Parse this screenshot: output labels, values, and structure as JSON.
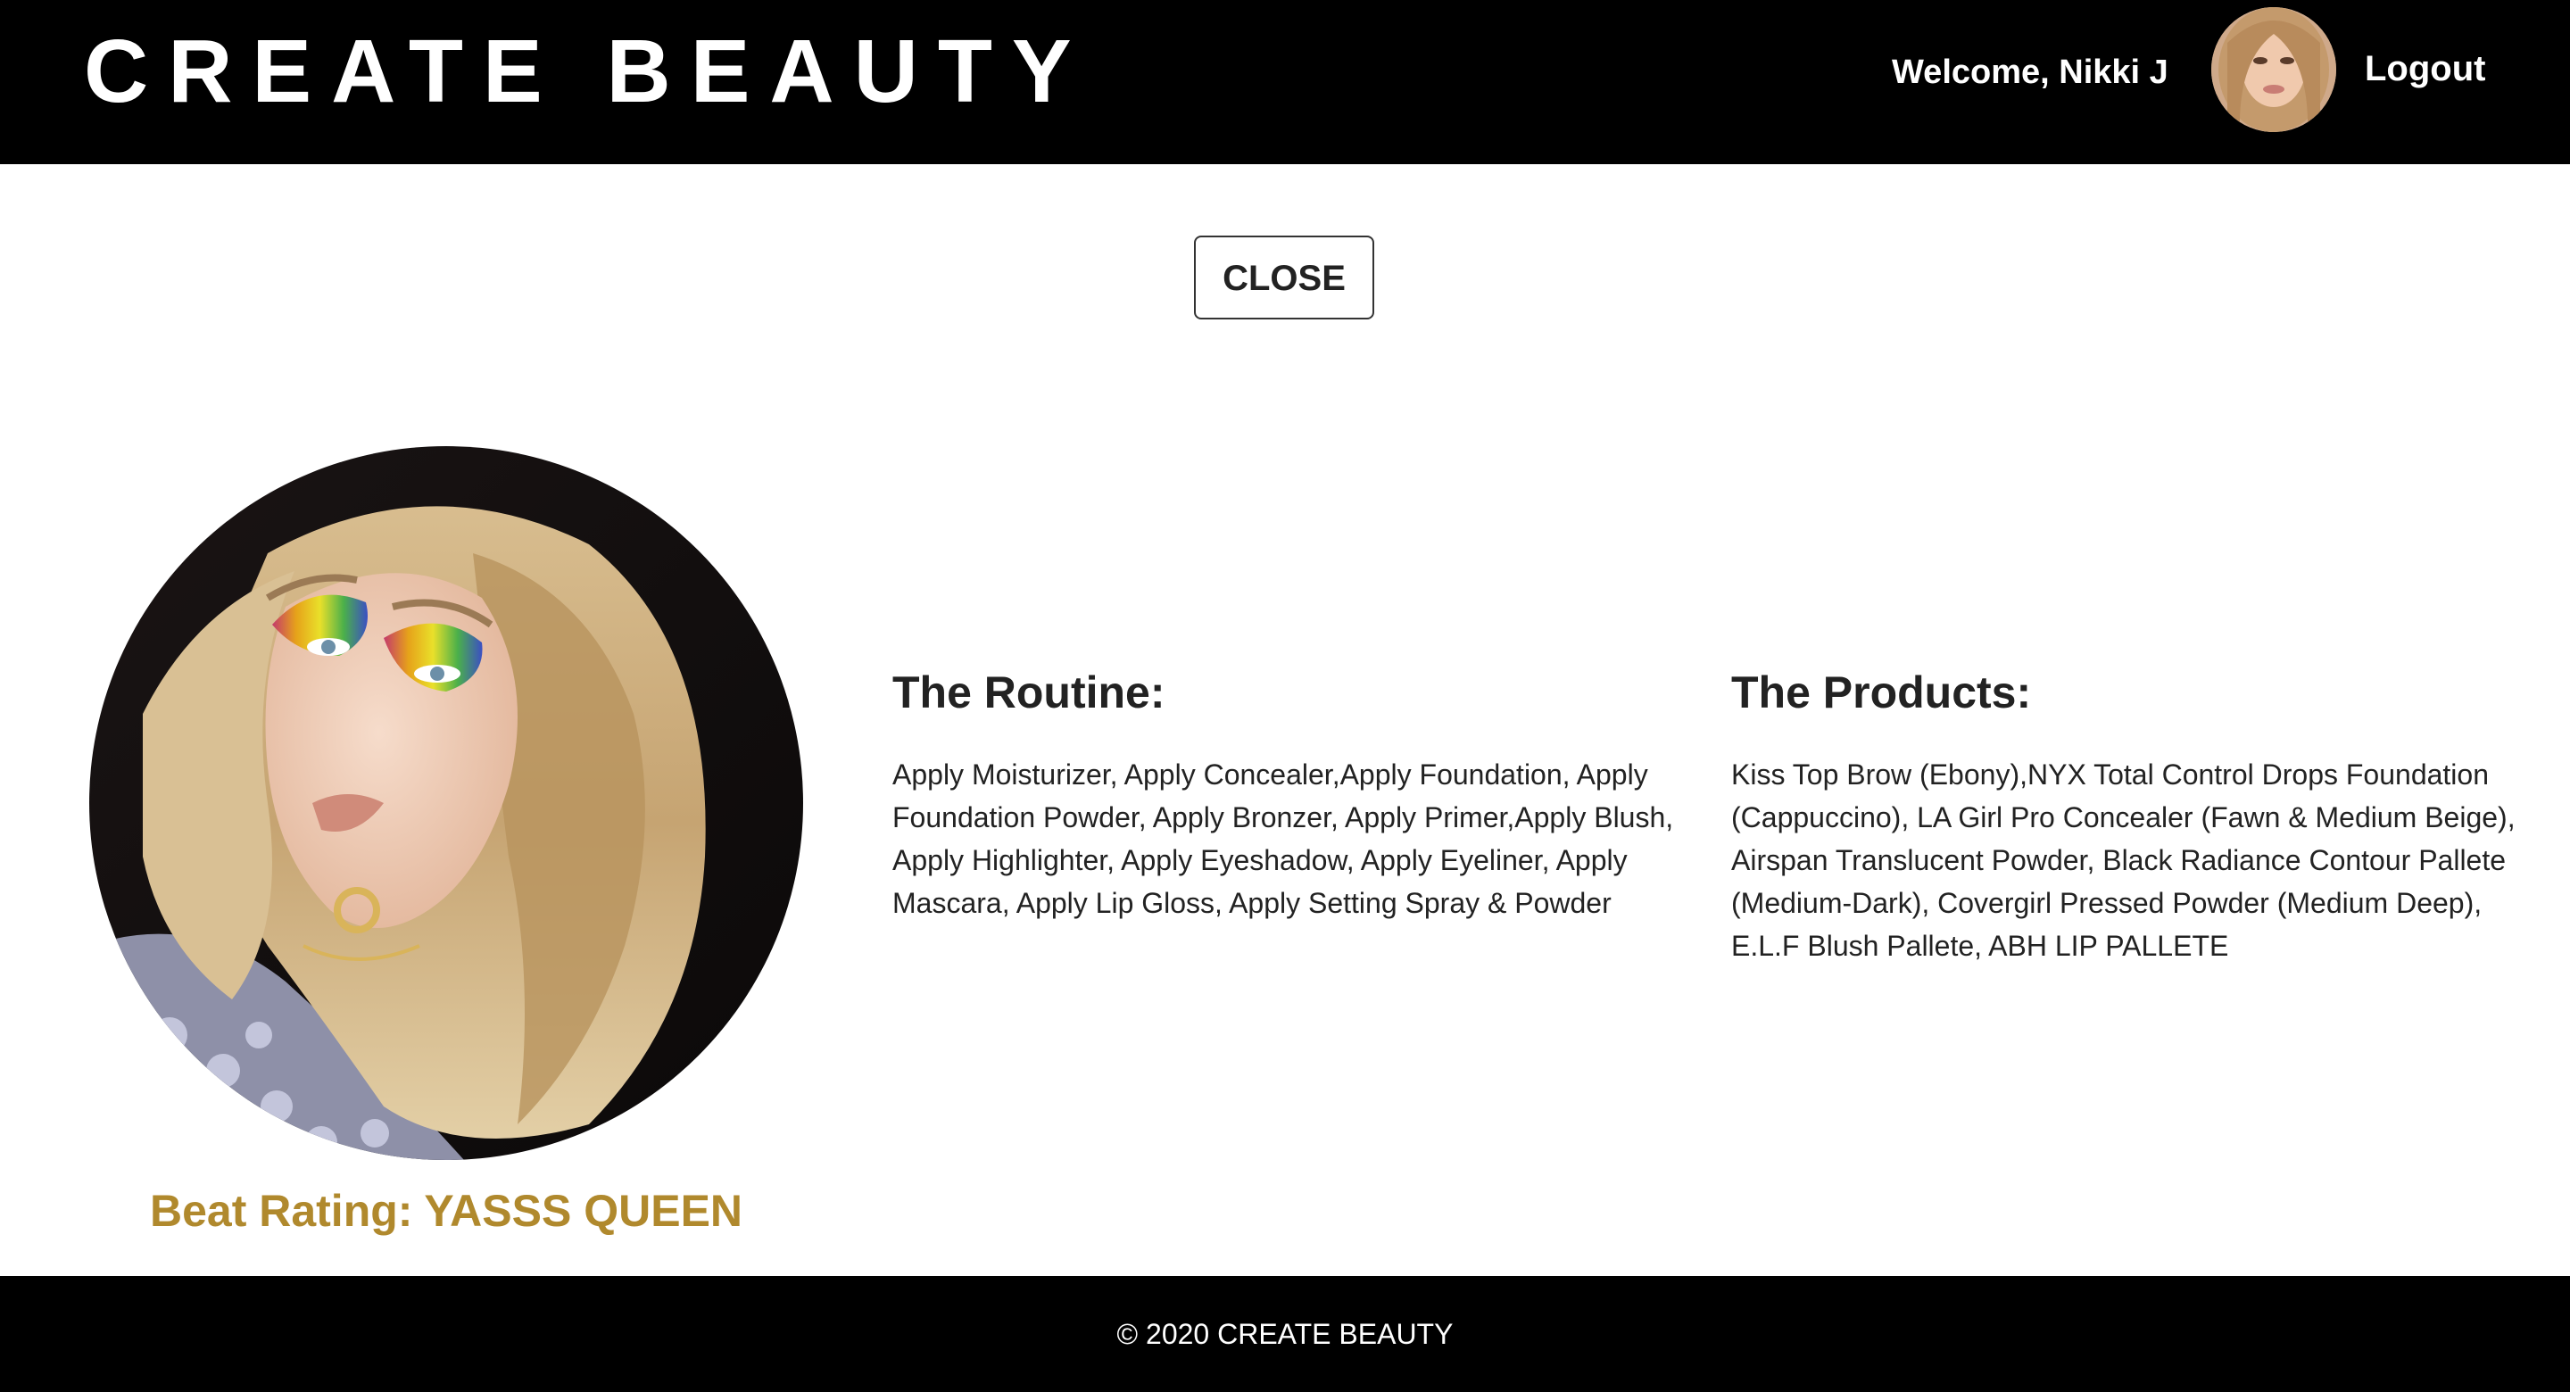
{
  "header": {
    "brand": "CREATE BEAUTY",
    "welcome": "Welcome, Nikki J",
    "logout_label": "Logout"
  },
  "modal": {
    "close_label": "CLOSE",
    "rating": "Beat Rating: YASSS QUEEN",
    "routine": {
      "title": "The Routine:",
      "text": "Apply Moisturizer, Apply Concealer,Apply Foundation, Apply Foundation Powder, Apply Bronzer, Apply Primer,Apply Blush, Apply Highlighter, Apply Eyeshadow, Apply Eyeliner, Apply Mascara, Apply Lip Gloss, Apply Setting Spray & Powder"
    },
    "products": {
      "title": "The Products:",
      "text": "Kiss Top Brow (Ebony),NYX Total Control Drops Foundation (Cappuccino), LA Girl Pro Concealer (Fawn & Medium Beige), Airspan Translucent Powder, Black Radiance Contour Pallete (Medium-Dark), Covergirl Pressed Powder (Medium Deep), E.L.F Blush Pallete, ABH LIP PALLETE"
    }
  },
  "footer": {
    "copyright": "© 2020 CREATE BEAUTY"
  },
  "colors": {
    "header_bg": "#000000",
    "accent_gold": "#b0892d",
    "text": "#222222"
  }
}
